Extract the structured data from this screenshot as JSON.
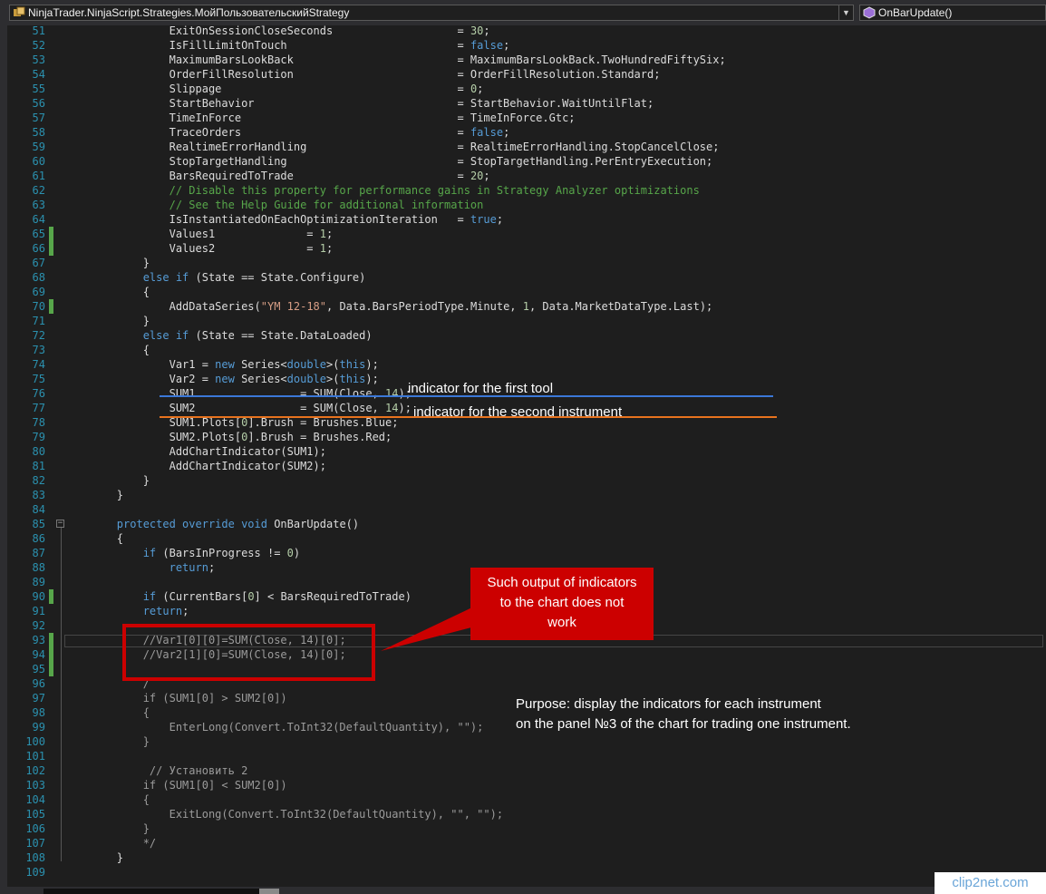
{
  "toolbar": {
    "class_dropdown": "NinjaTrader.NinjaScript.Strategies.МойПользовательскийStrategy",
    "method_dropdown": "OnBarUpdate()"
  },
  "code_lines": [
    {
      "n": "51",
      "mark": false,
      "html": "        ExitOnSessionCloseSeconds                   = <span class=\"num\">30</span>;"
    },
    {
      "n": "52",
      "mark": false,
      "html": "        IsFillLimitOnTouch                          = <span class=\"kw\">false</span>;"
    },
    {
      "n": "53",
      "mark": false,
      "html": "        MaximumBarsLookBack                         = MaximumBarsLookBack.TwoHundredFiftySix;"
    },
    {
      "n": "54",
      "mark": false,
      "html": "        OrderFillResolution                         = OrderFillResolution.Standard;"
    },
    {
      "n": "55",
      "mark": false,
      "html": "        Slippage                                    = <span class=\"num\">0</span>;"
    },
    {
      "n": "56",
      "mark": false,
      "html": "        StartBehavior                               = StartBehavior.WaitUntilFlat;"
    },
    {
      "n": "57",
      "mark": false,
      "html": "        TimeInForce                                 = TimeInForce.Gtc;"
    },
    {
      "n": "58",
      "mark": false,
      "html": "        TraceOrders                                 = <span class=\"kw\">false</span>;"
    },
    {
      "n": "59",
      "mark": false,
      "html": "        RealtimeErrorHandling                       = RealtimeErrorHandling.StopCancelClose;"
    },
    {
      "n": "60",
      "mark": false,
      "html": "        StopTargetHandling                          = StopTargetHandling.PerEntryExecution;"
    },
    {
      "n": "61",
      "mark": false,
      "html": "        BarsRequiredToTrade                         = <span class=\"num\">20</span>;"
    },
    {
      "n": "62",
      "mark": false,
      "html": "        <span class=\"cm\">// Disable this property for performance gains in Strategy Analyzer optimizations</span>"
    },
    {
      "n": "63",
      "mark": false,
      "html": "        <span class=\"cm\">// See the Help Guide for additional information</span>"
    },
    {
      "n": "64",
      "mark": false,
      "html": "        IsInstantiatedOnEachOptimizationIteration   = <span class=\"kw\">true</span>;"
    },
    {
      "n": "65",
      "mark": true,
      "html": "        Values1              = <span class=\"num\">1</span>;"
    },
    {
      "n": "66",
      "mark": true,
      "html": "        Values2              = <span class=\"num\">1</span>;"
    },
    {
      "n": "67",
      "mark": false,
      "html": "    }"
    },
    {
      "n": "68",
      "mark": false,
      "html": "    <span class=\"kw\">else if</span> (State == State.Configure)"
    },
    {
      "n": "69",
      "mark": false,
      "html": "    {"
    },
    {
      "n": "70",
      "mark": true,
      "html": "        AddDataSeries(<span class=\"str\">\"YM 12-18\"</span>, Data.BarsPeriodType.Minute, <span class=\"num\">1</span>, Data.MarketDataType.Last);"
    },
    {
      "n": "71",
      "mark": false,
      "html": "    }"
    },
    {
      "n": "72",
      "mark": false,
      "html": "    <span class=\"kw\">else if</span> (State == State.DataLoaded)"
    },
    {
      "n": "73",
      "mark": false,
      "html": "    {"
    },
    {
      "n": "74",
      "mark": false,
      "html": "        Var1 = <span class=\"kw\">new</span> Series&lt;<span class=\"kw\">double</span>&gt;(<span class=\"kw\">this</span>);"
    },
    {
      "n": "75",
      "mark": false,
      "html": "        Var2 = <span class=\"kw\">new</span> Series&lt;<span class=\"kw\">double</span>&gt;(<span class=\"kw\">this</span>);"
    },
    {
      "n": "76",
      "mark": false,
      "html": "        SUM1                = SUM(Close, <span class=\"num\">14</span>);"
    },
    {
      "n": "77",
      "mark": false,
      "html": "        SUM2                = SUM(Close, <span class=\"num\">14</span>);"
    },
    {
      "n": "78",
      "mark": false,
      "html": "        SUM1.Plots[<span class=\"num\">0</span>].Brush = Brushes.Blue;"
    },
    {
      "n": "79",
      "mark": false,
      "html": "        SUM2.Plots[<span class=\"num\">0</span>].Brush = Brushes.Red;"
    },
    {
      "n": "80",
      "mark": false,
      "html": "        AddChartIndicator(SUM1);"
    },
    {
      "n": "81",
      "mark": false,
      "html": "        AddChartIndicator(SUM2);"
    },
    {
      "n": "82",
      "mark": false,
      "html": "    }"
    },
    {
      "n": "83",
      "mark": false,
      "html": "}"
    },
    {
      "n": "84",
      "mark": false,
      "html": ""
    },
    {
      "n": "85",
      "mark": false,
      "html": "<span class=\"kw\">protected override void</span> OnBarUpdate()"
    },
    {
      "n": "86",
      "mark": false,
      "html": "{"
    },
    {
      "n": "87",
      "mark": false,
      "html": "    <span class=\"kw\">if</span> (BarsInProgress != <span class=\"num\">0</span>)"
    },
    {
      "n": "88",
      "mark": false,
      "html": "        <span class=\"kw\">return</span>;"
    },
    {
      "n": "89",
      "mark": false,
      "html": ""
    },
    {
      "n": "90",
      "mark": true,
      "html": "    <span class=\"kw\">if</span> (CurrentBars[<span class=\"num\">0</span>] &lt; BarsRequiredToTrade)"
    },
    {
      "n": "91",
      "mark": false,
      "html": "    <span class=\"kw\">return</span>;"
    },
    {
      "n": "92",
      "mark": false,
      "html": ""
    },
    {
      "n": "93",
      "mark": true,
      "html": "    <span class=\"dim\">//Var1[0][0]=SUM(Close, 14)[0];</span>"
    },
    {
      "n": "94",
      "mark": true,
      "html": "    <span class=\"dim\">//Var2[1][0]=SUM(Close, 14)[0];</span>"
    },
    {
      "n": "95",
      "mark": true,
      "html": ""
    },
    {
      "n": "96",
      "mark": false,
      "html": "    <span class=\"dim\">/</span>"
    },
    {
      "n": "97",
      "mark": false,
      "html": "    <span class=\"dim\">if (SUM1[0] &gt; SUM2[0])</span>"
    },
    {
      "n": "98",
      "mark": false,
      "html": "    <span class=\"dim\">{</span>"
    },
    {
      "n": "99",
      "mark": false,
      "html": "        <span class=\"dim\">EnterLong(Convert.ToInt32(DefaultQuantity), \"\");</span>"
    },
    {
      "n": "100",
      "mark": false,
      "html": "    <span class=\"dim\">}</span>"
    },
    {
      "n": "101",
      "mark": false,
      "html": ""
    },
    {
      "n": "102",
      "mark": false,
      "html": "     <span class=\"dim\">// Установить 2</span>"
    },
    {
      "n": "103",
      "mark": false,
      "html": "    <span class=\"dim\">if (SUM1[0] &lt; SUM2[0])</span>"
    },
    {
      "n": "104",
      "mark": false,
      "html": "    <span class=\"dim\">{</span>"
    },
    {
      "n": "105",
      "mark": false,
      "html": "        <span class=\"dim\">ExitLong(Convert.ToInt32(DefaultQuantity), \"\", \"\");</span>"
    },
    {
      "n": "106",
      "mark": false,
      "html": "    <span class=\"dim\">}</span>"
    },
    {
      "n": "107",
      "mark": false,
      "html": "    <span class=\"dim\">*/</span>"
    },
    {
      "n": "108",
      "mark": false,
      "html": "}"
    },
    {
      "n": "109",
      "mark": false,
      "html": ""
    }
  ],
  "annotations": {
    "note_first": "indicator for the first tool",
    "note_second": "indicator for the second instrument",
    "callout_line1": "Such output of indicators",
    "callout_line2": "to the chart does not",
    "callout_line3": "work",
    "purpose_line1": "Purpose: display the indicators for each instrument",
    "purpose_line2": "on the panel №3 of the chart for trading one instrument."
  },
  "colors": {
    "blue_line": "#3b78d8",
    "orange_line": "#e8731e",
    "callout_red": "#cc0000"
  },
  "watermark": "clip2net.com"
}
